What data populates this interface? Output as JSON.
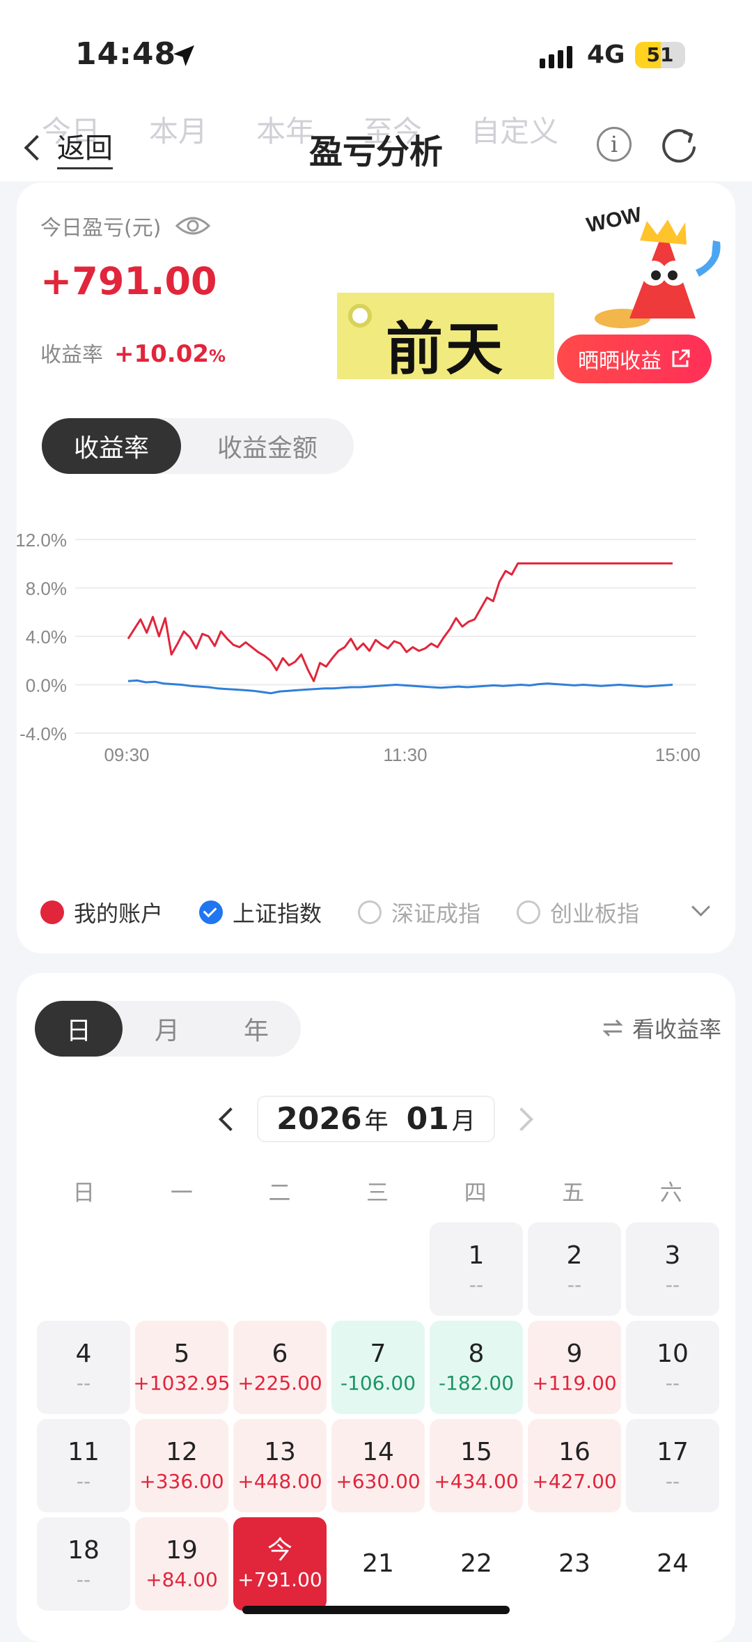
{
  "status_bar": {
    "time": "14:48",
    "network": "4G",
    "battery": "51",
    "battery_level": 0.51
  },
  "header": {
    "bg_tabs": [
      "今日",
      "本月",
      "本年",
      "至今",
      "自定义"
    ],
    "back_label": "返回",
    "title": "盈亏分析"
  },
  "summary": {
    "today_label": "今日盈亏(元)",
    "today_value": "+791.00",
    "rate_label": "收益率",
    "rate_value": "+10.02",
    "rate_unit": "%",
    "sticker_text": "前天",
    "share_label": "晒晒收益",
    "wow_text": "WOW"
  },
  "chart_tabs": [
    "收益率",
    "收益金额"
  ],
  "chart_data": {
    "type": "line",
    "x_ticks": [
      "09:30",
      "11:30",
      "15:00"
    ],
    "y_ticks": [
      "12.0%",
      "8.0%",
      "4.0%",
      "0.0%",
      "-4.0%"
    ],
    "ylim": [
      -4,
      12
    ],
    "grid": true,
    "series": [
      {
        "name": "我的账户",
        "color": "#e1253b",
        "values": [
          3.8,
          4.6,
          5.4,
          4.3,
          5.6,
          4.0,
          5.5,
          2.5,
          3.4,
          4.4,
          3.9,
          3.0,
          4.2,
          4.0,
          3.2,
          4.4,
          3.8,
          3.3,
          3.1,
          3.5,
          3.1,
          2.7,
          2.4,
          2.0,
          1.2,
          2.2,
          1.6,
          1.9,
          2.5,
          1.3,
          0.3,
          1.8,
          1.5,
          2.2,
          2.8,
          3.1,
          3.8,
          2.9,
          3.4,
          2.8,
          3.7,
          3.3,
          3.0,
          3.6,
          3.4,
          2.7,
          3.1,
          2.8,
          3.0,
          3.4,
          3.1,
          3.9,
          4.6,
          5.5,
          4.8,
          5.2,
          5.4,
          6.3,
          7.2,
          6.9,
          8.5,
          9.4,
          9.1,
          10.02,
          10.02,
          10.02,
          10.02,
          10.02,
          10.02,
          10.02,
          10.02,
          10.02,
          10.02,
          10.02,
          10.02,
          10.02,
          10.02,
          10.02,
          10.02,
          10.02,
          10.02,
          10.02,
          10.02,
          10.02,
          10.02,
          10.02,
          10.02,
          10.02,
          10.02
        ]
      },
      {
        "name": "上证指数",
        "color": "#2f7fd8",
        "values": [
          0.3,
          0.35,
          0.2,
          0.25,
          0.1,
          0.05,
          0.0,
          -0.1,
          -0.15,
          -0.2,
          -0.3,
          -0.35,
          -0.4,
          -0.45,
          -0.5,
          -0.6,
          -0.7,
          -0.55,
          -0.5,
          -0.45,
          -0.4,
          -0.35,
          -0.3,
          -0.3,
          -0.25,
          -0.2,
          -0.2,
          -0.15,
          -0.1,
          -0.05,
          0.0,
          -0.05,
          -0.1,
          -0.15,
          -0.2,
          -0.25,
          -0.2,
          -0.15,
          -0.2,
          -0.15,
          -0.1,
          -0.05,
          -0.1,
          -0.05,
          0.0,
          -0.05,
          0.05,
          0.1,
          0.05,
          0.0,
          -0.05,
          0.0,
          -0.05,
          -0.1,
          -0.05,
          0.0,
          -0.05,
          -0.1,
          -0.15,
          -0.1,
          -0.05,
          0.0
        ]
      }
    ]
  },
  "legend": {
    "items": [
      {
        "label": "我的账户",
        "state": "red"
      },
      {
        "label": "上证指数",
        "state": "checked"
      },
      {
        "label": "深证成指",
        "state": "off"
      },
      {
        "label": "创业板指",
        "state": "off"
      }
    ]
  },
  "calendar": {
    "tabs": [
      "日",
      "月",
      "年"
    ],
    "toggle_label": "看收益率",
    "year": "2026",
    "year_unit": "年",
    "month": "01",
    "month_unit": "月",
    "weekdays": [
      "日",
      "一",
      "二",
      "三",
      "四",
      "五",
      "六"
    ],
    "days": [
      {
        "day": "1",
        "value": "--",
        "kind": "gray",
        "col": 4,
        "row": 0
      },
      {
        "day": "2",
        "value": "--",
        "kind": "gray",
        "col": 5,
        "row": 0
      },
      {
        "day": "3",
        "value": "--",
        "kind": "gray",
        "col": 6,
        "row": 0
      },
      {
        "day": "4",
        "value": "--",
        "kind": "gray",
        "col": 0,
        "row": 1
      },
      {
        "day": "5",
        "value": "+1032.95",
        "kind": "up",
        "col": 1,
        "row": 1
      },
      {
        "day": "6",
        "value": "+225.00",
        "kind": "up",
        "col": 2,
        "row": 1
      },
      {
        "day": "7",
        "value": "-106.00",
        "kind": "down",
        "col": 3,
        "row": 1
      },
      {
        "day": "8",
        "value": "-182.00",
        "kind": "down",
        "col": 4,
        "row": 1
      },
      {
        "day": "9",
        "value": "+119.00",
        "kind": "up",
        "col": 5,
        "row": 1
      },
      {
        "day": "10",
        "value": "--",
        "kind": "gray",
        "col": 6,
        "row": 1
      },
      {
        "day": "11",
        "value": "--",
        "kind": "gray",
        "col": 0,
        "row": 2
      },
      {
        "day": "12",
        "value": "+336.00",
        "kind": "up",
        "col": 1,
        "row": 2
      },
      {
        "day": "13",
        "value": "+448.00",
        "kind": "up",
        "col": 2,
        "row": 2
      },
      {
        "day": "14",
        "value": "+630.00",
        "kind": "up",
        "col": 3,
        "row": 2
      },
      {
        "day": "15",
        "value": "+434.00",
        "kind": "up",
        "col": 4,
        "row": 2
      },
      {
        "day": "16",
        "value": "+427.00",
        "kind": "up",
        "col": 5,
        "row": 2
      },
      {
        "day": "17",
        "value": "--",
        "kind": "gray",
        "col": 6,
        "row": 2
      },
      {
        "day": "18",
        "value": "--",
        "kind": "gray",
        "col": 0,
        "row": 3
      },
      {
        "day": "19",
        "value": "+84.00",
        "kind": "up",
        "col": 1,
        "row": 3
      },
      {
        "day": "今",
        "value": "+791.00",
        "kind": "today",
        "col": 2,
        "row": 3
      },
      {
        "day": "21",
        "value": "",
        "kind": "future",
        "col": 3,
        "row": 3
      },
      {
        "day": "22",
        "value": "",
        "kind": "future",
        "col": 4,
        "row": 3
      },
      {
        "day": "23",
        "value": "",
        "kind": "future",
        "col": 5,
        "row": 3
      },
      {
        "day": "24",
        "value": "",
        "kind": "future",
        "col": 6,
        "row": 3
      }
    ]
  }
}
